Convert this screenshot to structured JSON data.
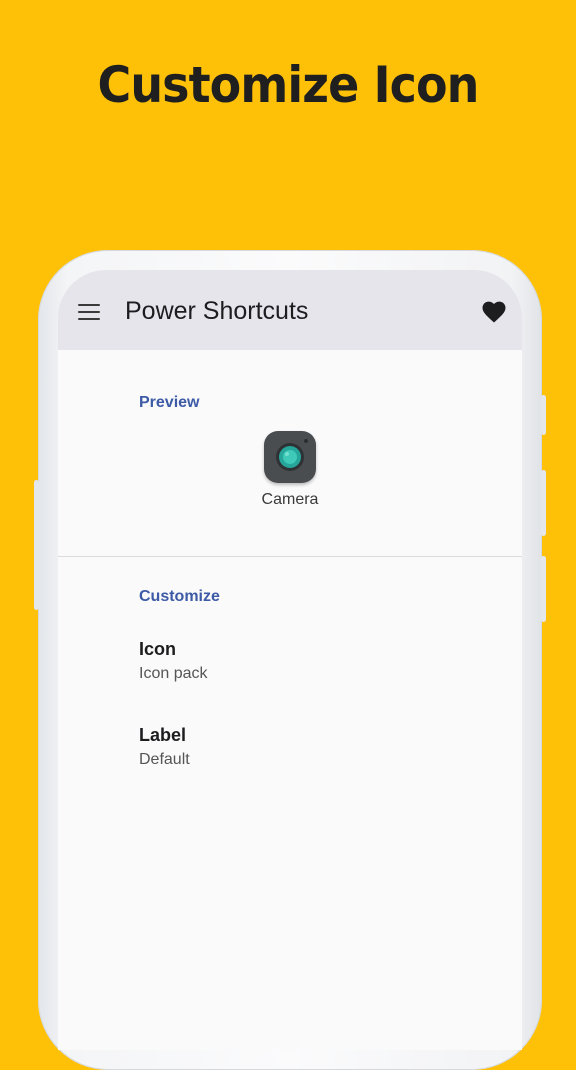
{
  "headline": "Customize Icon",
  "app": {
    "title": "Power Shortcuts"
  },
  "preview": {
    "section_title": "Preview",
    "shortcut_label": "Camera"
  },
  "customize": {
    "section_title": "Customize",
    "items": [
      {
        "title": "Icon",
        "subtitle": "Icon pack"
      },
      {
        "title": "Label",
        "subtitle": "Default"
      }
    ]
  },
  "icons": {
    "menu": "menu-icon",
    "favorite": "heart-icon",
    "shortcut": "camera-icon"
  },
  "colors": {
    "background": "#FFC107",
    "section_title": "#3d5aa6",
    "appbar": "#e6e5ec"
  }
}
